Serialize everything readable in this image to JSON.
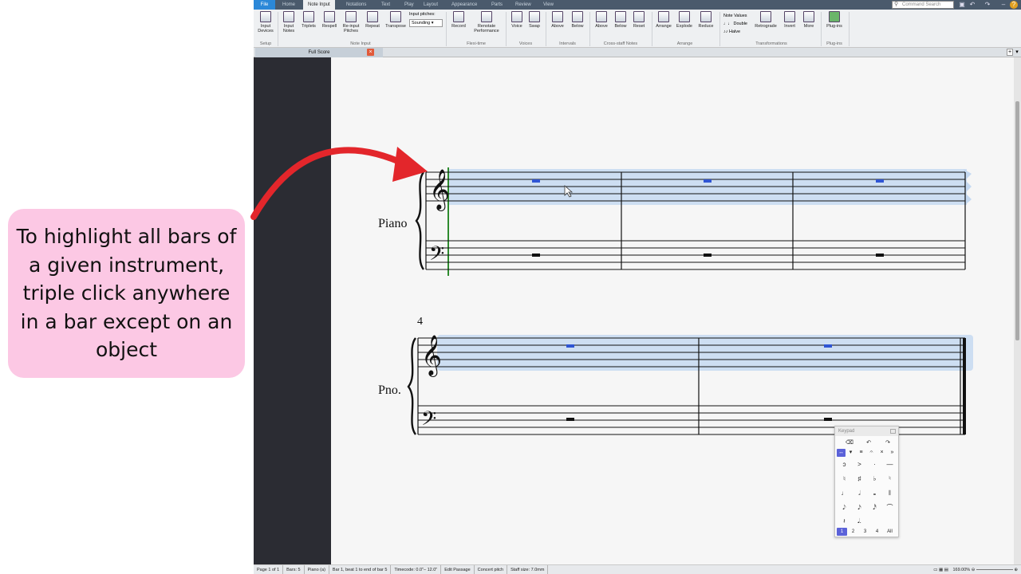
{
  "callout": {
    "text": "To highlight all bars of a given instrument, triple click anywhere in a bar except on an object",
    "background": "#fcc8e4",
    "arrow_color": "#e3262b"
  },
  "app": {
    "tabs": [
      "File",
      "Home",
      "Note Input",
      "Notations",
      "Text",
      "Play",
      "Layout",
      "Appearance",
      "Parts",
      "Review",
      "View"
    ],
    "active_tab": "Note Input",
    "command_search_placeholder": "Command Search",
    "ribbon_buttons": [
      {
        "label": "Input Devices",
        "icon": "keyboard-icon"
      },
      {
        "label": "Input Notes",
        "icon": "input-notes-icon"
      },
      {
        "label": "Triplets",
        "icon": "triplets-icon"
      },
      {
        "label": "Respell",
        "icon": "respell-icon"
      },
      {
        "label": "Re-input Pitches",
        "icon": "reinput-icon"
      },
      {
        "label": "Repeat",
        "icon": "repeat-icon"
      },
      {
        "label": "Transpose",
        "icon": "transpose-icon"
      },
      {
        "label": "Record",
        "icon": "record-icon"
      },
      {
        "label": "Renotate Performance",
        "icon": "renotate-icon"
      },
      {
        "label": "Voice",
        "icon": "voice-icon"
      },
      {
        "label": "Swap",
        "icon": "swap-icon"
      },
      {
        "label": "Above",
        "icon": "above-icon"
      },
      {
        "label": "Below",
        "icon": "below-icon"
      },
      {
        "label": "Above",
        "icon": "staff-above-icon"
      },
      {
        "label": "Below",
        "icon": "staff-below-icon"
      },
      {
        "label": "Reset",
        "icon": "reset-icon"
      },
      {
        "label": "Arrange",
        "icon": "arrange-icon"
      },
      {
        "label": "Explode",
        "icon": "explode-icon"
      },
      {
        "label": "Reduce",
        "icon": "reduce-icon"
      },
      {
        "label": "Retrograde",
        "icon": "retrograde-icon"
      },
      {
        "label": "Invert",
        "icon": "invert-icon"
      },
      {
        "label": "More",
        "icon": "more-icon"
      },
      {
        "label": "Plug-ins",
        "icon": "plugin-icon"
      }
    ],
    "input_pitches_label": "Input pitches:",
    "input_pitches_value": "Sounding",
    "note_values_label": "Note Values",
    "double_label": "Double",
    "halve_label": "Halve",
    "groups": [
      "Setup",
      "Note Input",
      "Flexi-time",
      "Voices",
      "Intervals",
      "Cross-staff Notes",
      "Arrange",
      "Transformations",
      "Plug-ins"
    ],
    "doc_tab": "Full Score",
    "accent": "#2b88d8"
  },
  "score": {
    "instrument_full": "Piano",
    "instrument_short": "Pno.",
    "bar_number": "4",
    "selection_color": "#c5d9f1",
    "rest_color": "#2f55d4"
  },
  "keypad": {
    "title": "Keypad",
    "rows": [
      [
        "⌫",
        "↶",
        "↷"
      ],
      [
        "↔",
        "▾",
        "≡",
        "𝄐",
        "×",
        "»"
      ],
      [
        "ɔ",
        ">",
        "·",
        "—"
      ],
      [
        "♮",
        "♯",
        "♭",
        "♮"
      ],
      [
        "♩",
        "𝅗𝅥",
        "𝅝",
        "𝄃"
      ],
      [
        "𝅘𝅥𝅮",
        "𝅘𝅥𝅯",
        "𝅘𝅥𝅰",
        "⌒"
      ],
      [
        "𝄽",
        "𝅘𝅥.",
        ""
      ]
    ],
    "layouts": [
      "1",
      "2",
      "3",
      "4",
      "All"
    ]
  },
  "status": {
    "items": [
      "Page 1 of 1",
      "Bars: 5",
      "Piano (a)",
      "Bar 1, beat 1 to end of bar 5",
      "Timecode: 0.0\"– 12.0\"",
      "Edit Passage",
      "Concert pitch",
      "Staff size: 7.0mm"
    ],
    "zoom": "169.00%"
  }
}
